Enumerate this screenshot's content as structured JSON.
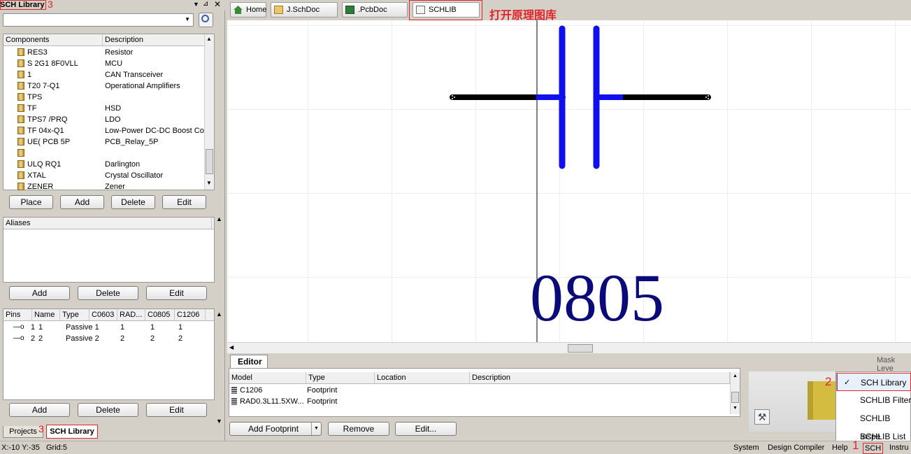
{
  "left_panel": {
    "title": "SCH Library",
    "title_annotation": "3",
    "components": {
      "headers": [
        "Components",
        "Description"
      ],
      "rows": [
        {
          "name": "RES3",
          "desc": "Resistor"
        },
        {
          "name": "S        2G1    8F0VLL",
          "desc": "MCU"
        },
        {
          "name": "               1",
          "desc": "CAN Transceiver"
        },
        {
          "name": "   T20  7-Q1",
          "desc": "Operational Amplifiers"
        },
        {
          "name": "TPS",
          "desc": ""
        },
        {
          "name": "TF",
          "desc": "HSD"
        },
        {
          "name": "TPS7     /PRQ",
          "desc": "LDO"
        },
        {
          "name": "TF     04x-Q1",
          "desc": "Low-Power DC-DC Boost Cor"
        },
        {
          "name": "UE(        PCB 5P",
          "desc": "PCB_Relay_5P"
        },
        {
          "name": "",
          "desc": ""
        },
        {
          "name": "ULQ         RQ1",
          "desc": "Darlington"
        },
        {
          "name": "XTAL",
          "desc": "Crystal Oscillator"
        },
        {
          "name": "ZENER",
          "desc": "Zener"
        }
      ],
      "buttons": [
        "Place",
        "Add",
        "Delete",
        "Edit"
      ]
    },
    "aliases": {
      "header": "Aliases",
      "buttons": [
        "Add",
        "Delete",
        "Edit"
      ]
    },
    "pins": {
      "headers": [
        "Pins",
        "Name",
        "Type",
        "C0603",
        "RAD...",
        "C0805",
        "C1206"
      ],
      "rows": [
        [
          "1",
          "1",
          "Passive",
          "1",
          "1",
          "1",
          "1"
        ],
        [
          "2",
          "2",
          "Passive",
          "2",
          "2",
          "2",
          "2"
        ]
      ],
      "buttons": [
        "Add",
        "Delete",
        "Edit"
      ]
    },
    "bottom_tabs": [
      "Projects",
      "SCH Library"
    ],
    "bottom_annotation": "3"
  },
  "doc_tabs": [
    {
      "label": "Home"
    },
    {
      "label": "      J.SchDoc"
    },
    {
      "label": "           .PcbDoc"
    },
    {
      "label": "      SCHLIB"
    }
  ],
  "open_lib_annotation": "打开原理图库",
  "canvas": {
    "footprint_text": "0805",
    "colors": {
      "body": "#1010ee",
      "lead": "#000000",
      "text": "#0a0a78"
    }
  },
  "editor": {
    "tab": "Editor",
    "headers": [
      "Model",
      "Type",
      "Location",
      "Description"
    ],
    "rows": [
      {
        "model": "C1206",
        "type": "Footprint"
      },
      {
        "model": "RAD0.3L11.5XW...",
        "type": "Footprint"
      }
    ],
    "buttons": {
      "add_footprint": "Add Footprint",
      "remove": "Remove",
      "edit": "Edit..."
    }
  },
  "mask_level": "Mask Leve",
  "popup_menu": {
    "annotation": "2",
    "items": [
      "SCH Library",
      "SCHLIB Filter",
      "SCHLIB Inspe",
      "SCHLIB List"
    ],
    "checked": "SCH Library"
  },
  "status_bar": {
    "coords": "X:-10 Y:-35",
    "grid": "Grid:5",
    "buttons": [
      "System",
      "Design Compiler",
      "Help",
      "SCH",
      "Instru"
    ],
    "annotation": "1"
  }
}
